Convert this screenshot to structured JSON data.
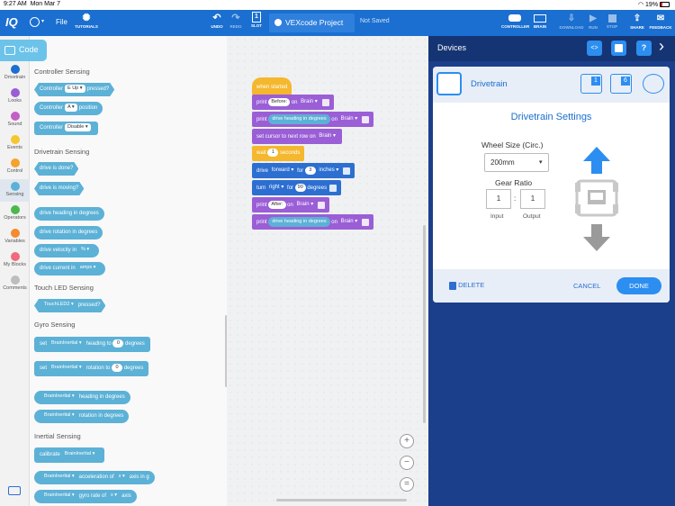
{
  "status": {
    "time": "9:27 AM",
    "date": "Mon Mar 7",
    "battery": "19%"
  },
  "topbar": {
    "logo": "IQ",
    "file_label": "File",
    "tutorials_label": "TUTORIALS",
    "undo_label": "UNDO",
    "redo_label": "REDO",
    "slot_label": "SLOT",
    "slot_number": "1",
    "project_title": "VEXcode Project",
    "save_state": "Not Saved",
    "controller_label": "CONTROLLER",
    "brain_label": "BRAIN",
    "download_label": "DOWNLOAD",
    "run_label": "RUN",
    "stop_label": "STOP",
    "share_label": "SHARE",
    "feedback_label": "FEEDBACK"
  },
  "code_tab": "Code",
  "categories": [
    {
      "label": "Drivetrain",
      "color": "#1a6fd0"
    },
    {
      "label": "Looks",
      "color": "#9a5ed6"
    },
    {
      "label": "Sound",
      "color": "#c35fc6"
    },
    {
      "label": "Events",
      "color": "#f5c72e"
    },
    {
      "label": "Control",
      "color": "#f5a22e"
    },
    {
      "label": "Sensing",
      "color": "#5cb1d6"
    },
    {
      "label": "Operators",
      "color": "#4cb84c"
    },
    {
      "label": "Variables",
      "color": "#f58a2e"
    },
    {
      "label": "My Blocks",
      "color": "#f06a7a"
    },
    {
      "label": "Comments",
      "color": "#bdbdbd"
    }
  ],
  "palette": {
    "controller_sensing": "Controller Sensing",
    "ctrl_pressed": {
      "a": "Controller",
      "b": "E Up",
      "c": "pressed?"
    },
    "ctrl_position": {
      "a": "Controller",
      "b": "A",
      "c": "position"
    },
    "ctrl_disable": {
      "a": "Controller",
      "b": "Disable"
    },
    "drivetrain_sensing": "Drivetrain Sensing",
    "drive_done": "drive is done?",
    "drive_moving": "drive is moving?",
    "drive_heading": "drive heading in degrees",
    "drive_rotation": "drive rotation in degrees",
    "drive_velocity": {
      "a": "drive velocity in",
      "b": "%"
    },
    "drive_current": {
      "a": "drive current in",
      "b": "amps"
    },
    "touch_led_sensing": "Touch LED Sensing",
    "touch_pressed": {
      "a": "TouchLED2",
      "b": "pressed?"
    },
    "gyro_sensing": "Gyro Sensing",
    "set_heading": {
      "a": "set",
      "b": "BrainInertial",
      "c": "heading to",
      "d": "0",
      "e": "degrees"
    },
    "set_rotation": {
      "a": "set",
      "b": "BrainInertial",
      "c": "rotation to",
      "d": "0",
      "e": "degrees"
    },
    "heading_rep": {
      "a": "BrainInertial",
      "b": "heading in degrees"
    },
    "rotation_rep": {
      "a": "BrainInertial",
      "b": "rotation in degrees"
    },
    "inertial_sensing": "Inertial Sensing",
    "calibrate": {
      "a": "calibrate",
      "b": "BrainInertial"
    },
    "accel": {
      "a": "BrainInertial",
      "b": "acceleration of",
      "c": "x",
      "d": "axis in g"
    },
    "gyro_rate": {
      "a": "BrainInertial",
      "b": "gyro rate of",
      "c": "x",
      "d": "axis"
    }
  },
  "script": {
    "hat": "when started",
    "print1": {
      "a": "print",
      "b": "Before:",
      "c": "on",
      "d": "Brain"
    },
    "print2": {
      "a": "print",
      "b": "drive heading in degrees",
      "c": "on",
      "d": "Brain"
    },
    "cursor": {
      "a": "set cursor to next row on",
      "b": "Brain"
    },
    "wait": {
      "a": "wait",
      "b": "1",
      "c": "seconds"
    },
    "drive": {
      "a": "drive",
      "b": "forward",
      "c": "for",
      "d": "3",
      "e": "inches"
    },
    "turn": {
      "a": "turn",
      "b": "right",
      "c": "for",
      "d": "90",
      "e": "degrees"
    },
    "print3": {
      "a": "print",
      "b": "After:",
      "c": "on",
      "d": "Brain"
    },
    "print4": {
      "a": "print",
      "b": "drive heading in degrees",
      "c": "on",
      "d": "Brain"
    }
  },
  "zoom": {
    "in": "+",
    "out": "−",
    "reset": "="
  },
  "devices": {
    "title": "Devices",
    "card_title": "Drivetrain",
    "port1": "1",
    "port2": "6",
    "settings_title": "Drivetrain Settings",
    "wheel_label": "Wheel Size (Circ.)",
    "wheel_value": "200mm",
    "gear_label": "Gear Ratio",
    "input_value": "1",
    "output_value": "1",
    "ratio_sep": ":",
    "input_label": "Input",
    "output_label": "Output",
    "delete_label": "DELETE",
    "cancel_label": "CANCEL",
    "done_label": "DONE"
  }
}
